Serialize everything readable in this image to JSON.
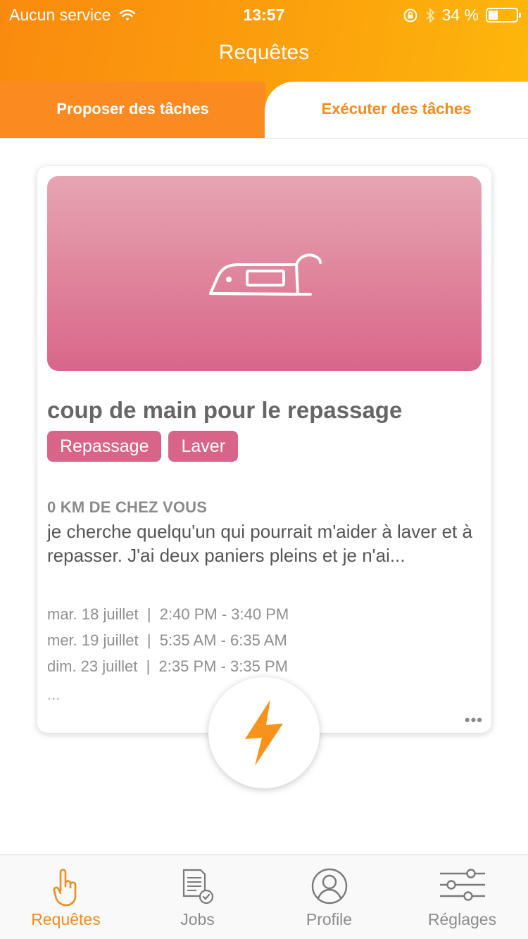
{
  "status_bar": {
    "carrier": "Aucun service",
    "time": "13:57",
    "battery": "34 %"
  },
  "nav": {
    "title": "Requêtes"
  },
  "tabs": [
    {
      "label": "Proposer des tâches",
      "selected": false
    },
    {
      "label": "Exécuter des tâches",
      "selected": true
    }
  ],
  "card": {
    "image_icon": "iron-icon",
    "title": "coup de main pour le repassage",
    "tags": [
      "Repassage",
      "Laver"
    ],
    "distance": "0 KM DE CHEZ VOUS",
    "description": "je cherche quelqu'un qui pourrait m'aider à laver et à repasser. J'ai deux paniers pleins et je n'ai...",
    "schedule": [
      "mar. 18 juillet  |  2:40 PM - 3:40 PM",
      "mer. 19 juillet  |  5:35 AM - 6:35 AM",
      "dim. 23 juillet  |  2:35 PM - 3:35 PM"
    ],
    "schedule_more": "...",
    "more": "•••"
  },
  "fab": {
    "icon": "lightning-icon"
  },
  "bottom_tabs": [
    {
      "label": "Requêtes",
      "icon": "hand-pointing-icon",
      "active": true
    },
    {
      "label": "Jobs",
      "icon": "document-check-icon",
      "active": false
    },
    {
      "label": "Profile",
      "icon": "user-circle-icon",
      "active": false
    },
    {
      "label": "Réglages",
      "icon": "sliders-icon",
      "active": false
    }
  ],
  "colors": {
    "accent": "#f28b1b",
    "header_start": "#fa8a0e",
    "header_end": "#fdb70b",
    "tag": "#d9648a",
    "hero_top": "#e6a5b2",
    "hero_bottom": "#d8668a"
  }
}
